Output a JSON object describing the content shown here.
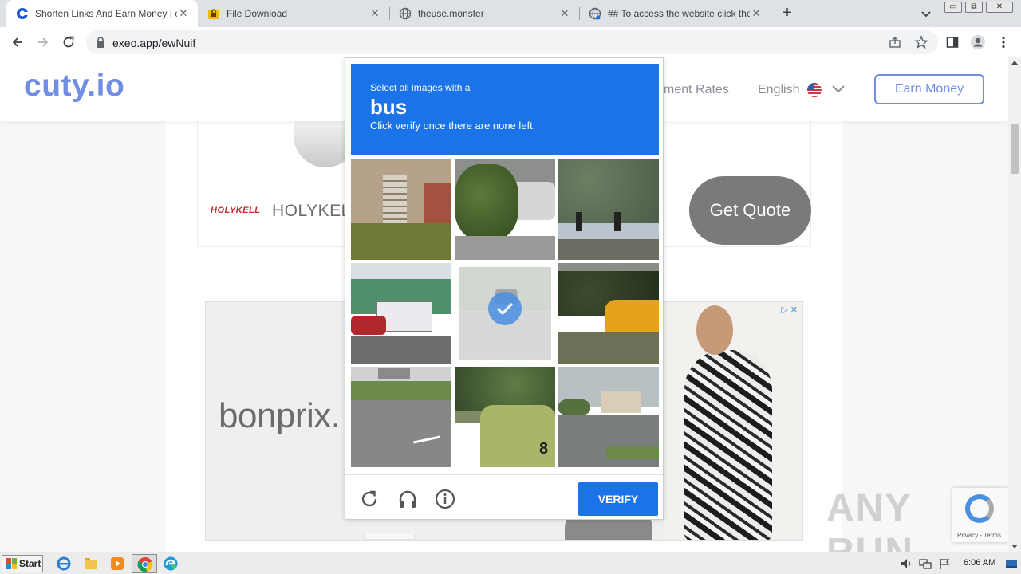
{
  "browser": {
    "tabs": [
      {
        "title": "Shorten Links And Earn Money | cut",
        "favicon": "cuty-icon",
        "active": true
      },
      {
        "title": "File Download",
        "favicon": "lock-folder-icon",
        "active": false
      },
      {
        "title": "theuse.monster",
        "favicon": "globe-icon",
        "active": false
      },
      {
        "title": "## To access the website click the \"/",
        "favicon": "globe-icon",
        "active": false
      }
    ],
    "url": "exeo.app/ewNuif"
  },
  "site": {
    "logo": "cuty.io",
    "nav_rates": "ment Rates",
    "language": "English",
    "earn_button": "Earn Money",
    "brand_color": "#6f8ee4"
  },
  "ads": {
    "holykell_mark": "HOLYKELL",
    "holykell_name": "HOLYKELL",
    "quote_button": "Get Quote",
    "bonprix": "bonprix."
  },
  "captcha": {
    "line1": "Select all images with a",
    "target": "bus",
    "line3": "Click verify once there are none left.",
    "verify_label": "VERIFY",
    "accent": "#1a73e8",
    "tiles": [
      {
        "name": "tile-house-stairs",
        "selected": false
      },
      {
        "name": "tile-bushes-street",
        "selected": false
      },
      {
        "name": "tile-traffic-lights",
        "selected": false
      },
      {
        "name": "tile-bus-street",
        "selected": false
      },
      {
        "name": "tile-road-car",
        "selected": true
      },
      {
        "name": "tile-school-bus",
        "selected": false
      },
      {
        "name": "tile-highway-truck",
        "selected": false
      },
      {
        "name": "tile-green-bus",
        "selected": false
      },
      {
        "name": "tile-road-building",
        "selected": false
      }
    ]
  },
  "recaptcha_badge": {
    "terms": "Privacy - Terms"
  },
  "watermark": "ANY RUN",
  "taskbar": {
    "start_label": "Start",
    "clock": "6:06 AM"
  }
}
